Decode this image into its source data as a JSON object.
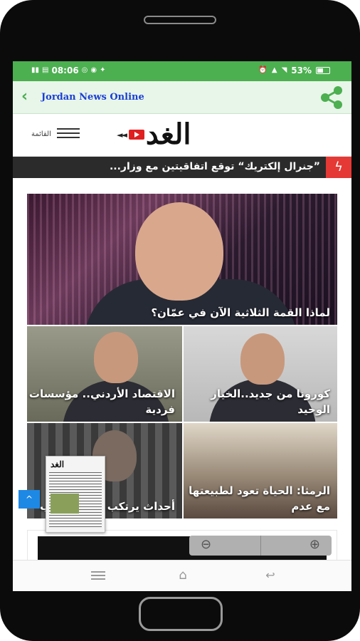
{
  "status_bar": {
    "time": "08:06",
    "battery": "53%",
    "battery_level": 0.53,
    "left_icons": [
      "sim-icon",
      "sim-icon",
      "data-icon",
      "whatsapp-icon",
      "messenger-icon",
      "twitter-icon"
    ],
    "right_icons": [
      "alarm-icon",
      "signal-icon",
      "wifi-icon",
      "battery-icon"
    ]
  },
  "app_bar": {
    "title": "Jordan News Online",
    "back_icon": "chevron-left-icon",
    "share_icon": "share-icon",
    "accent_color": "#4caf50",
    "title_color": "#1a3fd6"
  },
  "site_header": {
    "menu_label": "القائمة",
    "logo_text": "الغد",
    "logo_arrows": "◄◄"
  },
  "ticker": {
    "text": "”جنرال إلكتريك“ توقع اتفاقيتين مع وزار...",
    "badge_icon": "lightning-icon",
    "badge_glyph": "ϟ",
    "badge_color": "#e53935"
  },
  "articles": [
    {
      "title": "لماذا القمة الثلاثية الآن في عمّان؟"
    },
    {
      "title": "الاقتصاد الأردني.. مؤسسات فردية"
    },
    {
      "title": "كورونا من جديد..الخيار الوحيد"
    },
    {
      "title": "أحداث يرتكب قضية منذ ب"
    },
    {
      "title": "الرمثا: الحياة تعود لطبيعتها مع عدم"
    }
  ],
  "newspaper_thumb": {
    "masthead": "الغد"
  },
  "scroll_top": {
    "glyph": "^"
  },
  "zoom": {
    "out_glyph": "⊖",
    "in_glyph": "⊕"
  },
  "nav": {
    "home_glyph": "⌂",
    "back_glyph": "↩"
  }
}
